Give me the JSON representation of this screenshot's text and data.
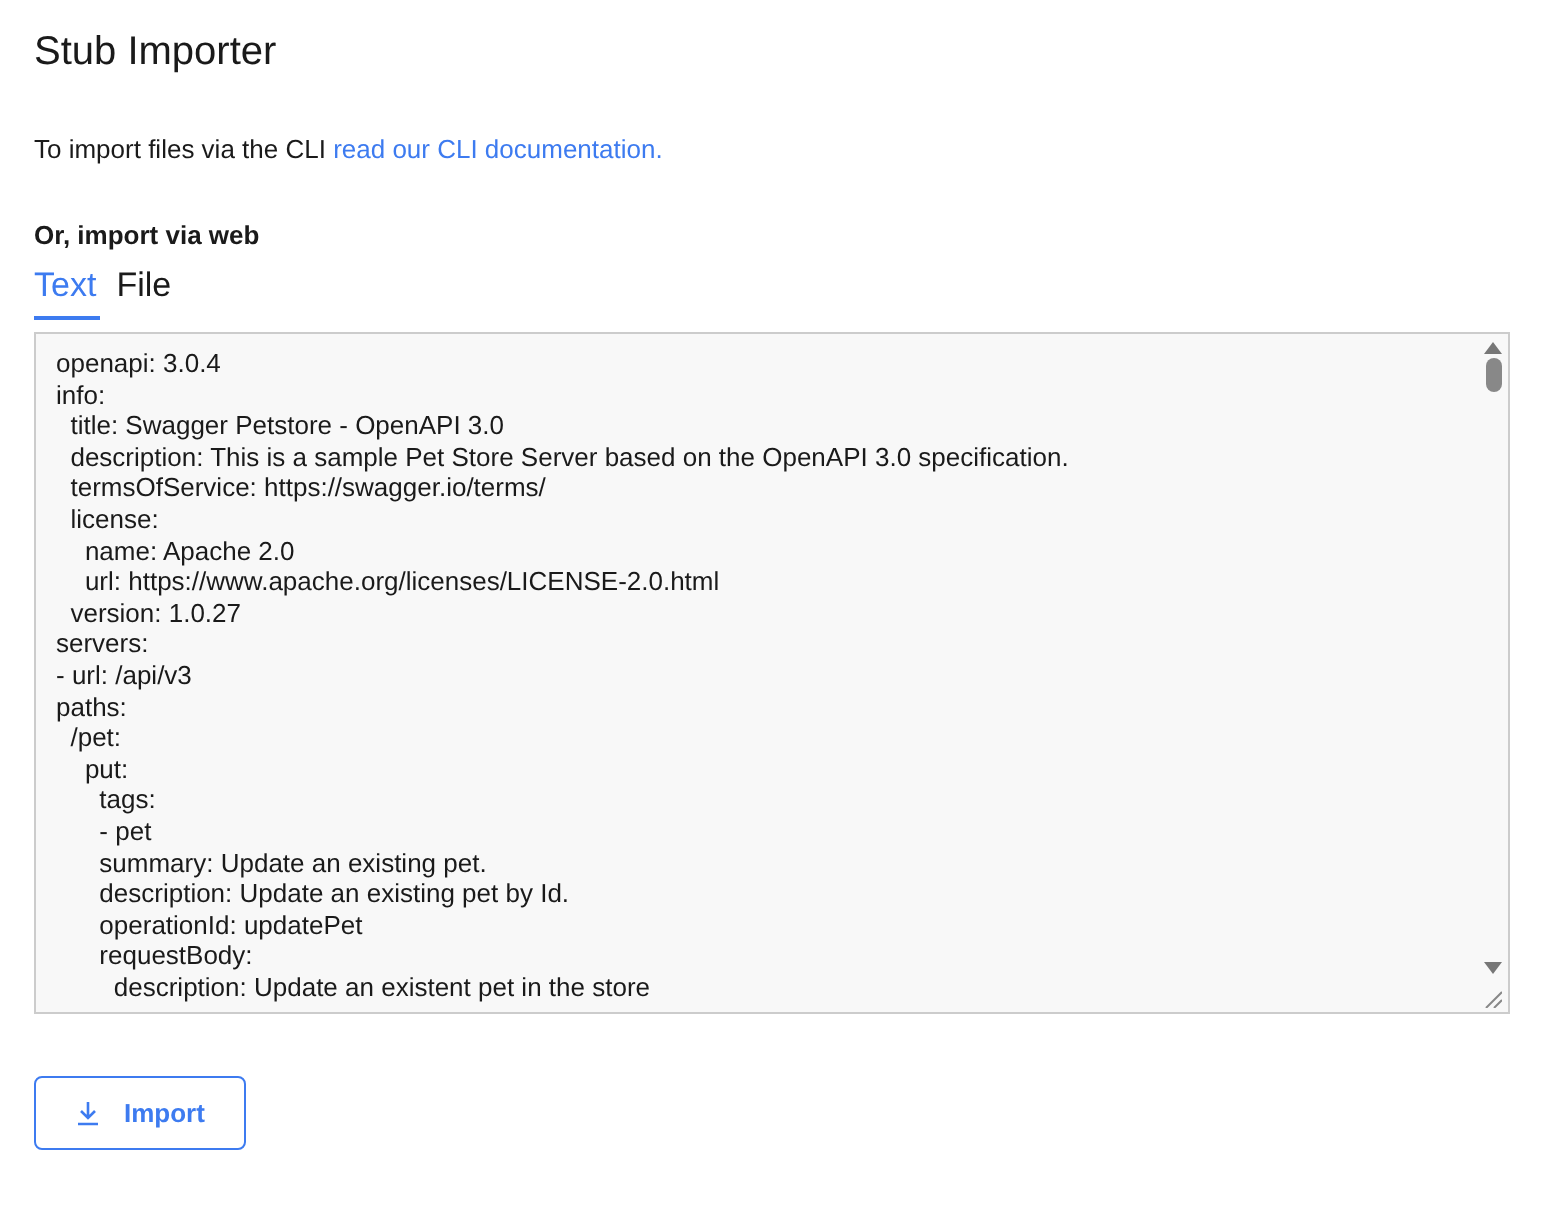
{
  "title": "Stub Importer",
  "intro": {
    "text": "To import files via the CLI",
    "link": "read our CLI documentation."
  },
  "section_label": "Or, import via web",
  "tabs": [
    {
      "label": "Text",
      "selected": true
    },
    {
      "label": "File",
      "selected": false
    }
  ],
  "editor": {
    "lines": [
      "openapi: 3.0.4",
      "info:",
      "  title: Swagger Petstore - OpenAPI 3.0",
      "  description: This is a sample Pet Store Server based on the OpenAPI 3.0 specification.",
      "  termsOfService: https://swagger.io/terms/",
      "  license:",
      "    name: Apache 2.0",
      "    url: https://www.apache.org/licenses/LICENSE-2.0.html",
      "  version: 1.0.27",
      "servers:",
      "- url: /api/v3",
      "paths:",
      "  /pet:",
      "    put:",
      "      tags:",
      "      - pet",
      "      summary: Update an existing pet.",
      "      description: Update an existing pet by Id.",
      "      operationId: updatePet",
      "      requestBody:",
      "        description: Update an existent pet in the store"
    ]
  },
  "import_button": "Import"
}
